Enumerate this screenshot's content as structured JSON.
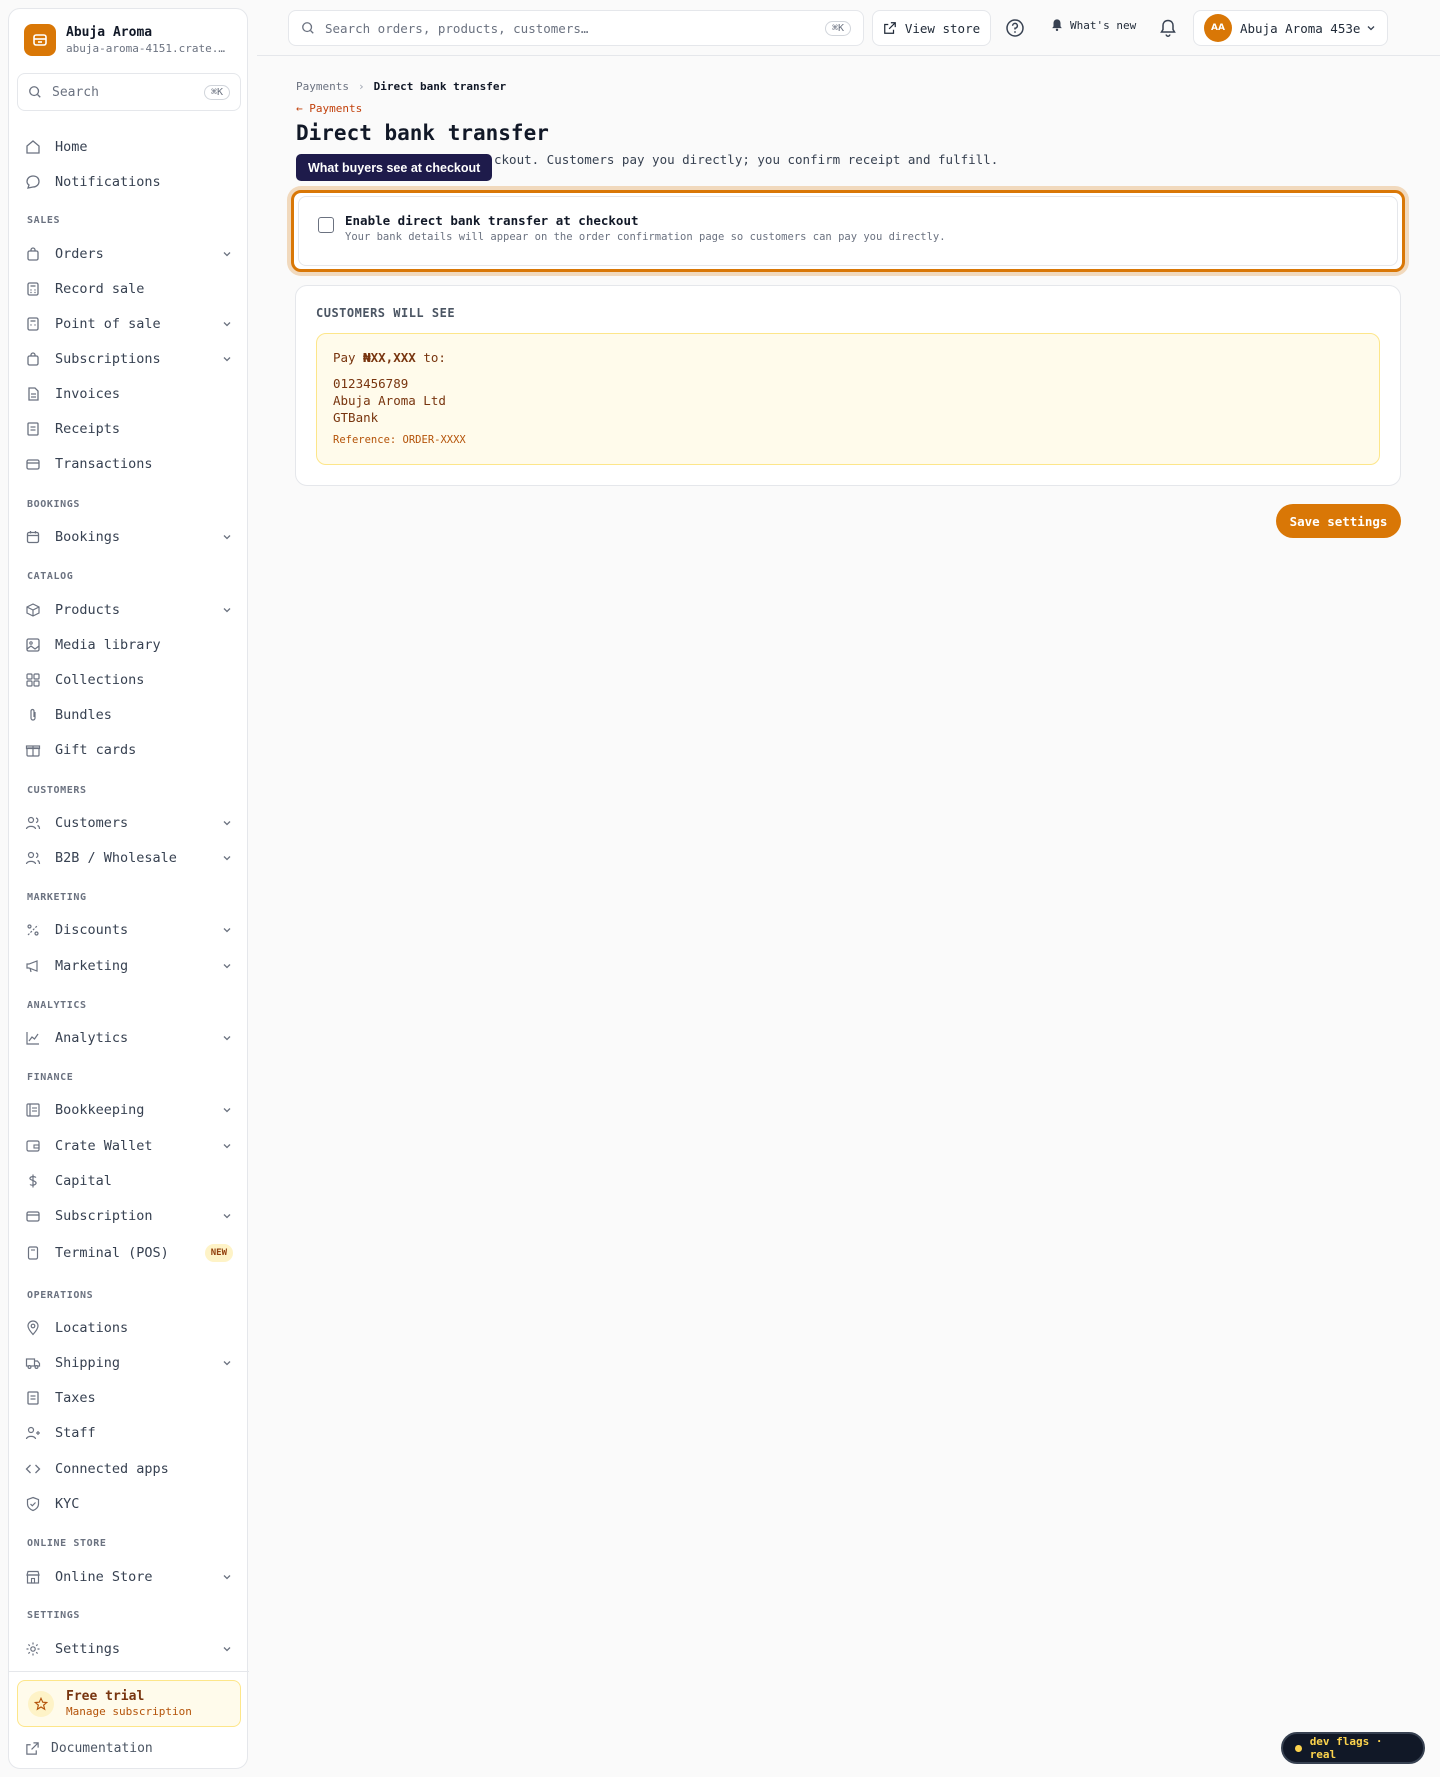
{
  "brand": {
    "name": "Abuja Aroma",
    "domain": "abuja-aroma-4151.crate.t…"
  },
  "sidebar": {
    "search_placeholder": "Search",
    "search_shortcut": "⌘K",
    "items": {
      "home": "Home",
      "notifications": "Notifications",
      "orders": "Orders",
      "record_sale": "Record sale",
      "point_of_sale": "Point of sale",
      "subscriptions": "Subscriptions",
      "invoices": "Invoices",
      "receipts": "Receipts",
      "transactions": "Transactions",
      "bookings": "Bookings",
      "products": "Products",
      "media_library": "Media library",
      "collections": "Collections",
      "bundles": "Bundles",
      "gift_cards": "Gift cards",
      "customers": "Customers",
      "b2b": "B2B / Wholesale",
      "discounts": "Discounts",
      "marketing": "Marketing",
      "analytics": "Analytics",
      "bookkeeping": "Bookkeeping",
      "crate_wallet": "Crate Wallet",
      "capital": "Capital",
      "subscription": "Subscription",
      "terminal": "Terminal (POS)",
      "locations": "Locations",
      "shipping": "Shipping",
      "taxes": "Taxes",
      "staff": "Staff",
      "connected_apps": "Connected apps",
      "kyc": "KYC",
      "online_store": "Online Store",
      "settings": "Settings"
    },
    "sections": {
      "sales": "SALES",
      "bookings": "BOOKINGS",
      "catalog": "CATALOG",
      "customers": "CUSTOMERS",
      "marketing": "MARKETING",
      "analytics": "ANALYTICS",
      "finance": "FINANCE",
      "operations": "OPERATIONS",
      "online_store": "ONLINE STORE",
      "settings": "SETTINGS"
    },
    "terminal_badge": "NEW",
    "trial": {
      "title": "Free trial",
      "subtitle": "Manage subscription"
    },
    "documentation": "Documentation"
  },
  "topbar": {
    "search_placeholder": "Search orders, products, customers…",
    "search_shortcut": "⌘K",
    "view_store": "View store",
    "whats_new": "What's new",
    "account_initials": "AA",
    "account_name": "Abuja Aroma 453e"
  },
  "main": {
    "breadcrumb": {
      "parent": "Payments",
      "current": "Direct bank transfer"
    },
    "back_link": "← Payments",
    "title": "Direct bank transfer",
    "description": "ckout. Customers pay you directly; you confirm receipt and fulfill.",
    "tooltip": "What buyers see at checkout",
    "enable": {
      "checked": false,
      "title": "Enable direct bank transfer at checkout",
      "subtitle": "Your bank details will appear on the order confirmation page so customers can pay you directly."
    },
    "preview": {
      "label": "CUSTOMERS WILL SEE",
      "pay_prefix": "Pay",
      "amount": "₦XX,XXX",
      "pay_suffix": "to:",
      "account_number": "0123456789",
      "account_name": "Abuja Aroma Ltd",
      "bank": "GTBank",
      "reference": "Reference: ORDER-XXXX"
    },
    "save_button": "Save settings"
  },
  "dev_flags": "dev flags · real",
  "colors": {
    "accent": "#d97706",
    "tooltip_bg": "#1e1b4b",
    "preview_bg": "#fffbeb"
  }
}
